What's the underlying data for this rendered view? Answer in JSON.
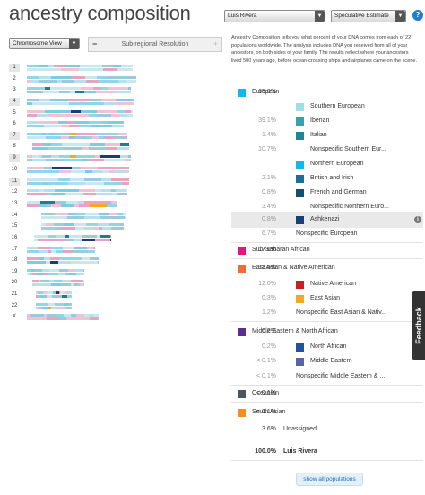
{
  "app": {
    "title": "ancestry composition",
    "profile_select": "Luis Rivera",
    "estimate_select": "Speculative Estimate",
    "help_label": "?"
  },
  "controls": {
    "chromosome_view": "Chromosome View",
    "resolution_label": "Sub-regional Resolution",
    "minus_label": "−",
    "plus_label": "+"
  },
  "intro_text": "Ancestry Composition tells you what percent of your DNA comes from each of 22 populations worldwide. The analysis includes DNA you received from all of your ancestors, on both sides of your family. The results reflect where your ancestors lived 500 years ago, before ocean-crossing ships and airplanes came on the scene.",
  "chromosomes": [
    {
      "label": "1"
    },
    {
      "label": "2"
    },
    {
      "label": "3"
    },
    {
      "label": "4"
    },
    {
      "label": "5"
    },
    {
      "label": "6"
    },
    {
      "label": "7"
    },
    {
      "label": "8"
    },
    {
      "label": "9"
    },
    {
      "label": "10"
    },
    {
      "label": "11"
    },
    {
      "label": "12"
    },
    {
      "label": "13"
    },
    {
      "label": "14"
    },
    {
      "label": "15"
    },
    {
      "label": "16"
    },
    {
      "label": "17"
    },
    {
      "label": "18"
    },
    {
      "label": "19"
    },
    {
      "label": "20"
    },
    {
      "label": "21"
    },
    {
      "label": "22"
    },
    {
      "label": "X"
    }
  ],
  "populations": [
    {
      "pct": "65.0%",
      "label": "European",
      "color": "#14b7ec",
      "level": 0
    },
    {
      "pct": "",
      "label": "Southern European",
      "color": "#a3dde4",
      "level": 1
    },
    {
      "pct": "39.1%",
      "label": "Iberian",
      "color": "#3c9fae",
      "level": 2
    },
    {
      "pct": "1.4%",
      "label": "Italian",
      "color": "#1f8790",
      "level": 2
    },
    {
      "pct": "10.7%",
      "label": "Nonspecific Southern Eur...",
      "color": "",
      "level": 2
    },
    {
      "pct": "",
      "label": "Northern European",
      "color": "#14b7ec",
      "level": 1
    },
    {
      "pct": "2.1%",
      "label": "British and Irish",
      "color": "#1a6f9a",
      "level": 2
    },
    {
      "pct": "0.8%",
      "label": "French and German",
      "color": "#124f70",
      "level": 2
    },
    {
      "pct": "3.4%",
      "label": "Nonspecific Northern Euro...",
      "color": "",
      "level": 2
    },
    {
      "pct": "0.8%",
      "label": "Ashkenazi",
      "color": "#183f78",
      "level": 1
    },
    {
      "pct": "6.7%",
      "label": "Nonspecific European",
      "color": "",
      "level": 1
    },
    {
      "pct": "17.6%",
      "label": "Sub-Saharan African",
      "color": "#e5157a",
      "level": 0
    },
    {
      "pct": "13.5%",
      "label": "East Asian & Native American",
      "color": "#f26b3a",
      "level": 0
    },
    {
      "pct": "12.0%",
      "label": "Native American",
      "color": "#c42127",
      "level": 1
    },
    {
      "pct": "0.3%",
      "label": "East Asian",
      "color": "#f6a91f",
      "level": 1
    },
    {
      "pct": "1.2%",
      "label": "Nonspecific East Asian & Nativ...",
      "color": "",
      "level": 1
    },
    {
      "pct": "0.2%",
      "label": "Middle Eastern & North African",
      "color": "#5a2d8f",
      "level": 0
    },
    {
      "pct": "0.2%",
      "label": "North African",
      "color": "#2451a0",
      "level": 1
    },
    {
      "pct": "< 0.1%",
      "label": "Middle Eastern",
      "color": "#5565a8",
      "level": 1
    },
    {
      "pct": "< 0.1%",
      "label": "Nonspecific Middle Eastern & ...",
      "color": "",
      "level": 1
    },
    {
      "pct": "< 0.1%",
      "label": "Oceanian",
      "color": "#495461",
      "level": 0
    },
    {
      "pct": "< 0.1%",
      "label": "South Asian",
      "color": "#f0901d",
      "level": 0
    },
    {
      "pct": "3.6%",
      "label": "Unassigned",
      "color": "",
      "level": 0
    },
    {
      "pct": "100.0%",
      "label": "Luis Rivera",
      "color": "",
      "level": 0
    }
  ],
  "show_all_label": "show all populations",
  "feedback_label": "Feedback"
}
